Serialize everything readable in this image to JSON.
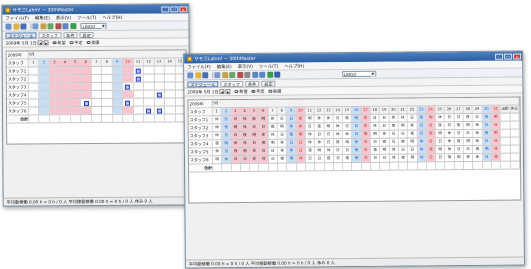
{
  "window1": {
    "title": "サモ三Lahm! ~ 30thMaster",
    "menu": [
      "ファイル(F)",
      "編集(E)",
      "表示(V)",
      "ツール(T)",
      "ヘルプ(H)"
    ],
    "tool_combo": "LINGO",
    "tabs": [
      "スケジュール",
      "スタッフ",
      "条件",
      "設定"
    ],
    "date_label": "2009年 5月 1日",
    "radios": [
      "希望",
      "予定",
      "実績"
    ],
    "grid_corner": "2009年",
    "month": "5月",
    "days": [
      "1",
      "2",
      "3",
      "4",
      "5",
      "6",
      "7",
      "8",
      "9",
      "10",
      "11",
      "12",
      "13",
      "14",
      "15"
    ],
    "staff": [
      "スタッフ",
      "スタッフ1",
      "スタッフ2",
      "スタッフ3",
      "スタッフ4",
      "スタッフ5",
      "スタッフ6"
    ],
    "total_label": "合計",
    "status": "平均動稼働 0.00 h = 0 h / 0 人 平均稼動稼働 0.00 h = 0 h / 0 人 休み 0 人"
  },
  "window2": {
    "title": "サモ三Lahm! ~ 30thMaster",
    "menu": [
      "ファイル(F)",
      "編集(E)",
      "表示(V)",
      "ツール(T)",
      "ヘルプ(H)"
    ],
    "tool_combo": "LINGO",
    "tabs": [
      "スケジュール",
      "スタッフ",
      "条件",
      "設定"
    ],
    "date_label": "2009年 5月 1日",
    "radios": [
      "希望",
      "予定",
      "実績"
    ],
    "grid_corner": "2009年",
    "month": "5月",
    "days": [
      "1",
      "2",
      "3",
      "4",
      "5",
      "6",
      "7",
      "8",
      "9",
      "10",
      "11",
      "12",
      "13",
      "14",
      "15",
      "16",
      "17",
      "18",
      "19",
      "20",
      "21",
      "22",
      "23",
      "24",
      "25",
      "26",
      "27",
      "28",
      "29",
      "30",
      "31"
    ],
    "extra_cols": [
      "出勤",
      "休日"
    ],
    "staff": [
      "スタッフ",
      "スタッフ1",
      "スタッフ2",
      "スタッフ3",
      "スタッフ4",
      "スタッフ5",
      "スタッフ6"
    ],
    "shift_codes": [
      "日",
      "夜",
      "明",
      "休"
    ],
    "total_label": "合計",
    "status": "平均動稼働 0.00 h = 0 h / 0 人 平均稼動稼働 0.00 h = 0 h / 0 人 休み 0 人"
  },
  "colors": {
    "titlebar": "#2c5ea3",
    "holiday": "#f5c6cf",
    "weekend": "#c9ddf3",
    "mark": "#2a3fb0"
  }
}
